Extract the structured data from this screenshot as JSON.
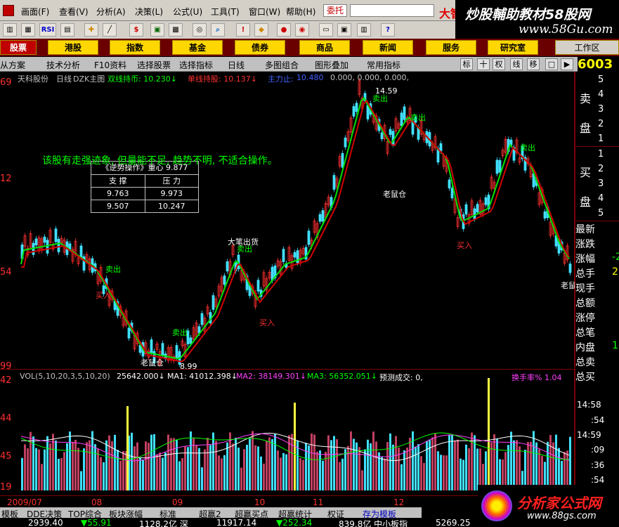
{
  "menu": [
    "画面(F)",
    "查看(V)",
    "分析(A)",
    "决策(L)",
    "公式(U)",
    "工具(T)",
    "窗口(W)",
    "帮助(H)"
  ],
  "menu_extra": {
    "wt": "委托",
    "brand": "大智"
  },
  "watermark": {
    "title": "炒股輔助教材58股网",
    "url": "www.58Gu.com"
  },
  "toolbar": {
    "rsi": "RSI",
    "dollar": "$"
  },
  "tabs": [
    "股票",
    "港股",
    "指数",
    "基金",
    "债券",
    "商品",
    "新闻",
    "服务",
    "研究室",
    "工作区"
  ],
  "subbar": [
    "从方案",
    "技术分析",
    "F10资料",
    "选择股票",
    "选择指标",
    "日线",
    "多图组合",
    "图形叠加",
    "常用指标"
  ],
  "sub_buttons": [
    "标",
    "十",
    "权",
    "线",
    "移",
    "□",
    "▶"
  ],
  "code": "6003",
  "chart_title": {
    "stock": "天科股份",
    "period": "日线",
    "indicator": "DZK主图",
    "l1": "双线持币: 10.230↓",
    "l2": "单线持股: 10.137↓",
    "l3": "主力止:",
    "l4": "10.480",
    "l5": "0.000, 0.000, 0.000,"
  },
  "support_table": {
    "title": "《逆势操作》重心 9.877",
    "h1": "支  撑",
    "h2": "压  力",
    "rows": [
      [
        "9.763",
        "9.973"
      ],
      [
        "9.507",
        "10.247"
      ]
    ]
  },
  "comment": "该股有走强迹象, 但量能不足, 趋势不明, 不适合操作。",
  "y_left": [
    "69",
    "12",
    "54",
    "99"
  ],
  "vol_left": [
    "42",
    "44",
    "45",
    "19"
  ],
  "annot": {
    "s1": "14.59",
    "s2": "8.99",
    "chu1": "卖出",
    "ru": "买入",
    "lao": "老鼠仓",
    "big": "大笔出货"
  },
  "vol_title": {
    "a": "VOL(5,10,20,3,5,10,20)",
    "b": "25642.000↓",
    "c": "MA1: 41012.398↓",
    "d": "MA2: 38149.301↓",
    "e": "MA3: 56352.051↓",
    "f": "预测成交: 0,",
    "g": "换手率% 1.04"
  },
  "dates": [
    "2009/07",
    "08",
    "09",
    "10",
    "11",
    "12"
  ],
  "right": {
    "sell": "卖",
    "sell2": "盘",
    "buy": "买",
    "buy2": "盘",
    "n": [
      "5",
      "4",
      "3",
      "2",
      "1",
      "1",
      "2",
      "3",
      "4",
      "5"
    ],
    "labels": [
      "最新",
      "涨跌",
      "涨幅",
      "总手",
      "现手",
      "总额",
      "涨停",
      "总笔",
      "内盘",
      "总卖",
      "总买"
    ],
    "v1": "-2",
    "v2": "2",
    "v3": "1",
    "times": [
      "14:58",
      ":54",
      "14:59",
      ":09",
      ":36",
      ":54"
    ]
  },
  "btabs": [
    "模板",
    "DDE决策",
    "TOP综合",
    "板块涨幅",
    "标准",
    "超赢2",
    "超赢买点",
    "超赢统计",
    "权证",
    "存为模板"
  ],
  "status": [
    "2939.40",
    "▼55.91",
    "1128.2亿 深",
    "11917.14",
    "▼252.34",
    "839.8亿 中小板指",
    "5269.25"
  ],
  "logo": {
    "name": "分析家公式网",
    "url": "www.88gs.com"
  }
}
